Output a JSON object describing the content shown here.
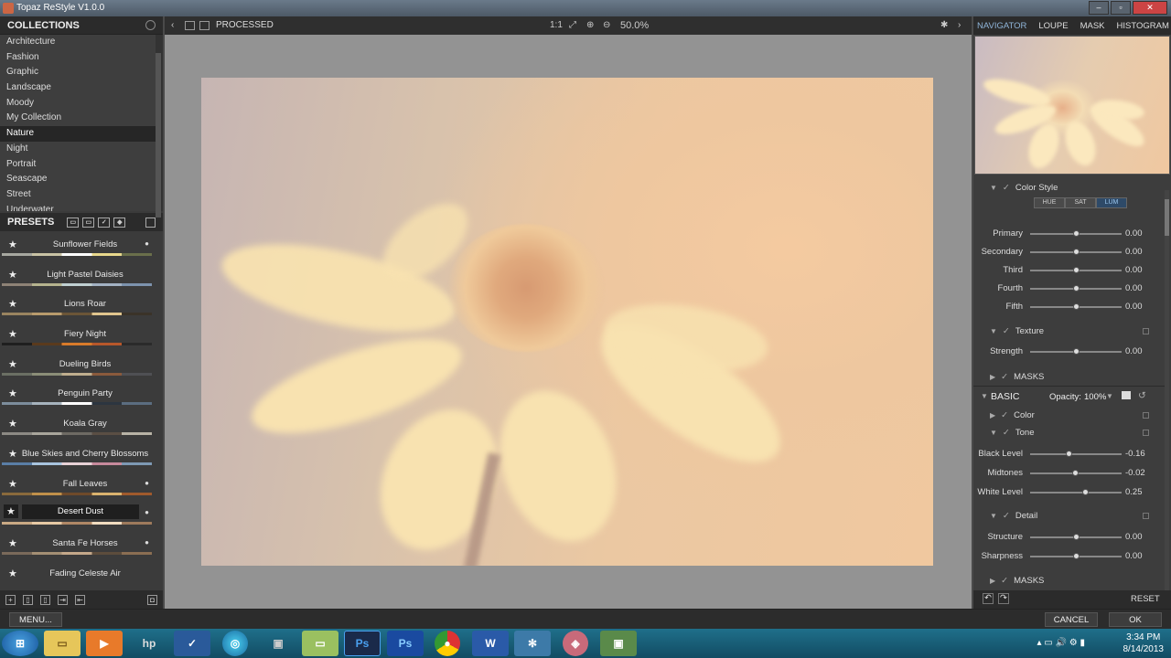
{
  "window": {
    "title": "Topaz ReStyle V1.0.0"
  },
  "collections": {
    "header": "COLLECTIONS",
    "items": [
      "Architecture",
      "Fashion",
      "Graphic",
      "Landscape",
      "Moody",
      "My Collection",
      "Nature",
      "Night",
      "Portrait",
      "Seascape",
      "Street",
      "Underwater"
    ],
    "selected": "Nature"
  },
  "presets": {
    "header": "PRESETS",
    "items": [
      {
        "name": "Sunflower Fields",
        "colors": [
          "#a7a8a0",
          "#c9c3a5",
          "#ffffff",
          "#e8d88c",
          "#6a6f4b"
        ]
      },
      {
        "name": "Light Pastel Daisies",
        "colors": [
          "#8e8276",
          "#b5b38e",
          "#c0d0d2",
          "#a3b2c3",
          "#7d93ae"
        ]
      },
      {
        "name": "Lions Roar",
        "colors": [
          "#9a8460",
          "#b89b6c",
          "#6b5537",
          "#e0c58e",
          "#3a3328"
        ]
      },
      {
        "name": "Fiery Night",
        "colors": [
          "#1f1f1f",
          "#5a3a1d",
          "#d97b2a",
          "#b7572a",
          "#2a2a2a"
        ]
      },
      {
        "name": "Dueling Birds",
        "colors": [
          "#6b6f64",
          "#8b8e78",
          "#bfae8e",
          "#8a5a3c",
          "#4f5054"
        ]
      },
      {
        "name": "Penguin Party",
        "colors": [
          "#7d8d9c",
          "#a7b3bd",
          "#ffffff",
          "#2c3540",
          "#5b6d80"
        ]
      },
      {
        "name": "Koala Gray",
        "colors": [
          "#8c8a84",
          "#a9a69c",
          "#6e6b64",
          "#5a4e44",
          "#b8b3a6"
        ]
      },
      {
        "name": "Blue Skies and Cherry Blossoms",
        "colors": [
          "#5a7ea6",
          "#a8c4de",
          "#e7d1d6",
          "#c78a9c",
          "#7d99b4"
        ]
      },
      {
        "name": "Fall Leaves",
        "colors": [
          "#8a6a3c",
          "#c0904a",
          "#6f4a2a",
          "#d9b26e",
          "#a05a2c"
        ]
      },
      {
        "name": "Desert Dust",
        "colors": [
          "#c9a984",
          "#e6c9a4",
          "#b08866",
          "#f0dcc0",
          "#9e7a5c"
        ]
      },
      {
        "name": "Santa Fe Horses",
        "colors": [
          "#7a6a5a",
          "#a48f74",
          "#c4a88a",
          "#5c4c3c",
          "#8b6e52"
        ]
      },
      {
        "name": "Fading Celeste Air",
        "colors": [
          "#9aa6b0",
          "#c2ccd3",
          "#dce2e6",
          "#8895a0",
          "#b0bac2"
        ]
      }
    ],
    "selected": "Desert Dust"
  },
  "toolbar": {
    "view_label": "PROCESSED",
    "zoom_one_to_one": "1:1",
    "zoom_level": "50.0%"
  },
  "right_tabs": [
    "NAVIGATOR",
    "LOUPE",
    "MASK",
    "HISTOGRAM"
  ],
  "color_style": {
    "title": "Color Style",
    "modes": [
      "HUE",
      "SAT",
      "LUM"
    ],
    "active_mode": "LUM",
    "sliders": [
      {
        "label": "Primary",
        "value": "0.00",
        "pos": 0.5
      },
      {
        "label": "Secondary",
        "value": "0.00",
        "pos": 0.5
      },
      {
        "label": "Third",
        "value": "0.00",
        "pos": 0.5
      },
      {
        "label": "Fourth",
        "value": "0.00",
        "pos": 0.5
      },
      {
        "label": "Fifth",
        "value": "0.00",
        "pos": 0.5
      }
    ]
  },
  "texture": {
    "title": "Texture",
    "sliders": [
      {
        "label": "Strength",
        "value": "0.00",
        "pos": 0.5
      }
    ]
  },
  "masks_label": "MASKS",
  "basic": {
    "title": "BASIC",
    "opacity_label": "Opacity:",
    "opacity_value": "100%"
  },
  "color_section": "Color",
  "tone": {
    "title": "Tone",
    "sliders": [
      {
        "label": "Black Level",
        "value": "-0.16",
        "pos": 0.42
      },
      {
        "label": "Midtones",
        "value": "-0.02",
        "pos": 0.49
      },
      {
        "label": "White Level",
        "value": "0.25",
        "pos": 0.6
      }
    ]
  },
  "detail": {
    "title": "Detail",
    "sliders": [
      {
        "label": "Structure",
        "value": "0.00",
        "pos": 0.5
      },
      {
        "label": "Sharpness",
        "value": "0.00",
        "pos": 0.5
      }
    ]
  },
  "masks_label_2": "MASKS",
  "footer": {
    "reset_label": "RESET",
    "menu_label": "MENU...",
    "cancel_label": "CANCEL",
    "ok_label": "OK"
  },
  "taskbar": {
    "time": "3:34 PM",
    "date": "8/14/2013"
  }
}
